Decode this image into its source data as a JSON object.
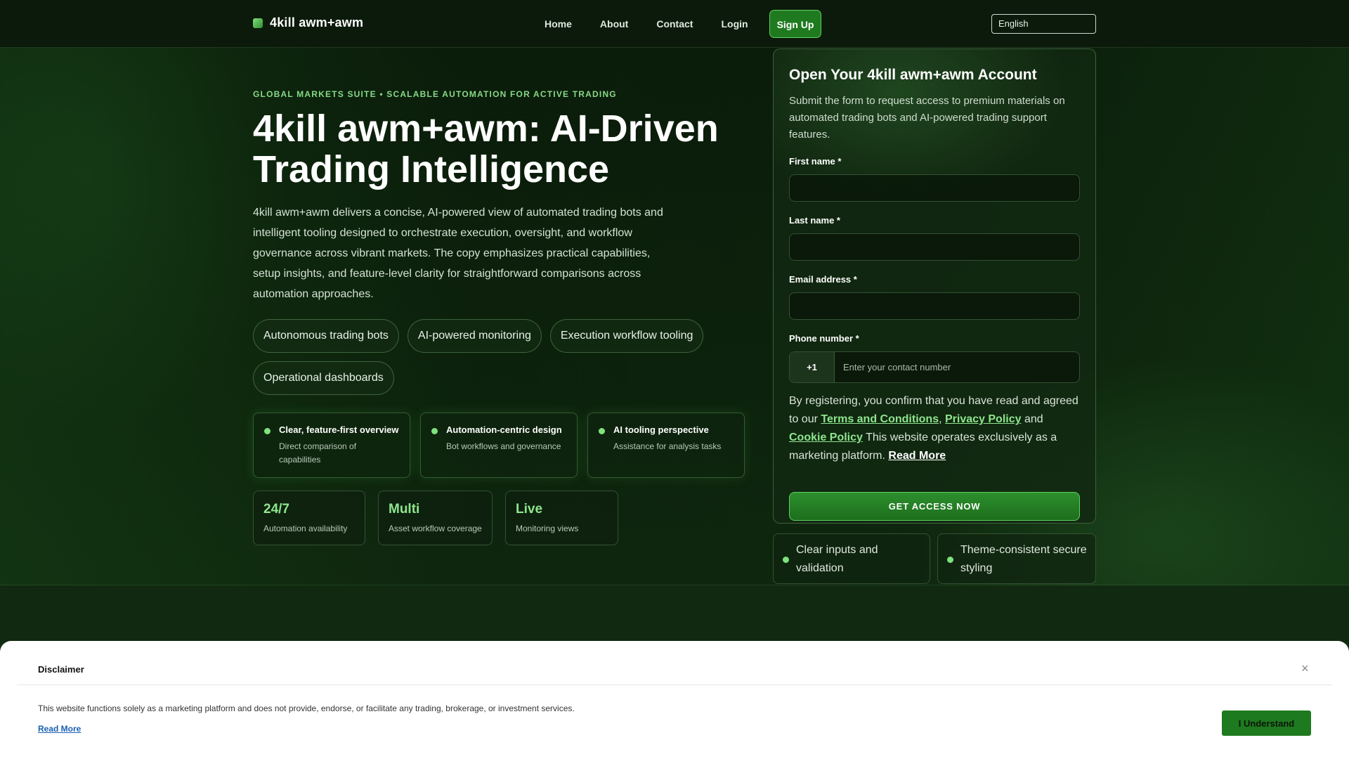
{
  "brand": {
    "name": "4kill awm+awm"
  },
  "nav": {
    "links": [
      "Home",
      "About",
      "Contact",
      "Login"
    ],
    "signup": "Sign Up",
    "language": "English"
  },
  "hero": {
    "eyebrow": "GLOBAL MARKETS SUITE • SCALABLE AUTOMATION FOR ACTIVE TRADING",
    "title": "4kill awm+awm: AI-Driven Trading Intelligence",
    "description": "4kill awm+awm delivers a concise, AI-powered view of automated trading bots and intelligent tooling designed to orchestrate execution, oversight, and workflow governance across vibrant markets. The copy emphasizes practical capabilities, setup insights, and feature-level clarity for straightforward comparisons across automation approaches.",
    "chips": [
      "Autonomous trading bots",
      "AI-powered monitoring",
      "Execution workflow tooling",
      "Operational dashboards"
    ],
    "features": [
      {
        "title": "Clear, feature-first overview",
        "sub": "Direct comparison of capabilities"
      },
      {
        "title": "Automation-centric design",
        "sub": "Bot workflows and governance"
      },
      {
        "title": "AI tooling perspective",
        "sub": "Assistance for analysis tasks"
      }
    ],
    "stats": [
      {
        "value": "24/7",
        "label": "Automation availability"
      },
      {
        "value": "Multi",
        "label": "Asset workflow coverage"
      },
      {
        "value": "Live",
        "label": "Monitoring views"
      }
    ]
  },
  "form": {
    "title": "Open Your 4kill awm+awm Account",
    "description": "Submit the form to request access to premium materials on automated trading bots and AI-powered trading support features.",
    "first_name_label": "First name *",
    "last_name_label": "Last name *",
    "email_label": "Email address *",
    "phone_label": "Phone number *",
    "phone_code": "+1",
    "phone_placeholder": "Enter your contact number",
    "consent_prefix": "By registering, you confirm that you have read and agreed to our",
    "terms": "Terms and Conditions",
    "privacy": "Privacy Policy",
    "and": "and",
    "cookie": "Cookie Policy",
    "consent_suffix": "This website operates exclusively as a marketing platform.",
    "read_more": "Read More",
    "submit": "GET ACCESS NOW"
  },
  "badges": [
    "Clear inputs and validation",
    "Theme-consistent secure styling"
  ],
  "disclaimer": {
    "title": "Disclaimer",
    "close": "×",
    "text": "This website functions solely as a marketing platform and does not provide, endorse, or facilitate any trading, brokerage, or investment services.",
    "read_more": "Read More",
    "button": "I Understand"
  },
  "colors": {
    "accent": "#1f7a1f",
    "accent_light": "#8ee68e",
    "background": "#0c1f0c"
  }
}
